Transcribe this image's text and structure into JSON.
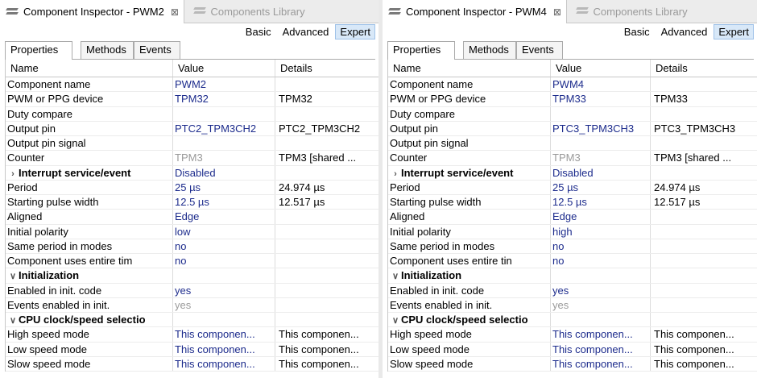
{
  "colors": {
    "value_blue": "#1c2b8c",
    "value_gray": "#9a9a9a",
    "expert_bg": "#d8e8f8"
  },
  "left": {
    "view_tab": "Component Inspector - PWM2",
    "close_glyph": "⊠",
    "library_tab": "Components Library",
    "modes": [
      "Basic",
      "Advanced",
      "Expert"
    ],
    "selected_mode": "Expert",
    "subtabs": [
      "Properties",
      "Methods",
      "Events"
    ],
    "columns": [
      "Name",
      "Value",
      "Details"
    ],
    "rows": [
      {
        "name": "Component name",
        "value": "PWM2",
        "details": "",
        "level": 1,
        "twist": "",
        "bold": false,
        "style": "blue"
      },
      {
        "name": "PWM or PPG device",
        "value": "TPM32",
        "details": "TPM32",
        "level": 1,
        "twist": "",
        "bold": false,
        "style": "blue"
      },
      {
        "name": "Duty compare",
        "value": "",
        "details": "",
        "level": 1,
        "twist": "",
        "bold": false,
        "style": "blue"
      },
      {
        "name": "Output pin",
        "value": "PTC2_TPM3CH2",
        "details": "PTC2_TPM3CH2",
        "level": 1,
        "twist": "",
        "bold": false,
        "style": "blue"
      },
      {
        "name": "Output pin signal",
        "value": "",
        "details": "",
        "level": 1,
        "twist": "",
        "bold": false,
        "style": "blue"
      },
      {
        "name": "Counter",
        "value": "TPM3",
        "details": "TPM3 [shared ...",
        "level": 1,
        "twist": "",
        "bold": false,
        "style": "gray"
      },
      {
        "name": "Interrupt service/event",
        "value": "Disabled",
        "details": "",
        "level": 0,
        "twist": ">",
        "bold": true,
        "style": "blue"
      },
      {
        "name": "Period",
        "value": "25 µs",
        "details": "24.974 µs",
        "level": 1,
        "twist": "",
        "bold": false,
        "style": "blue"
      },
      {
        "name": "Starting pulse width",
        "value": "12.5 µs",
        "details": "12.517 µs",
        "level": 1,
        "twist": "",
        "bold": false,
        "style": "blue"
      },
      {
        "name": "Aligned",
        "value": "Edge",
        "details": "",
        "level": 1,
        "twist": "",
        "bold": false,
        "style": "blue"
      },
      {
        "name": "Initial polarity",
        "value": "low",
        "details": "",
        "level": 1,
        "twist": "",
        "bold": false,
        "style": "blue"
      },
      {
        "name": "Same period in modes",
        "value": "no",
        "details": "",
        "level": 1,
        "twist": "",
        "bold": false,
        "style": "blue"
      },
      {
        "name": "Component uses entire tim",
        "value": "no",
        "details": "",
        "level": 1,
        "twist": "",
        "bold": false,
        "style": "blue"
      },
      {
        "name": "Initialization",
        "value": "",
        "details": "",
        "level": 0,
        "twist": "v",
        "bold": true,
        "style": "blue"
      },
      {
        "name": "Enabled in init. code",
        "value": "yes",
        "details": "",
        "level": 2,
        "twist": "",
        "bold": false,
        "style": "blue"
      },
      {
        "name": "Events enabled in init.",
        "value": "yes",
        "details": "",
        "level": 2,
        "twist": "",
        "bold": false,
        "style": "gray"
      },
      {
        "name": "CPU clock/speed selectio",
        "value": "",
        "details": "",
        "level": 0,
        "twist": "v",
        "bold": true,
        "style": "blue"
      },
      {
        "name": "High speed mode",
        "value": "This componen...",
        "details": "This componen...",
        "level": 2,
        "twist": "",
        "bold": false,
        "style": "blue"
      },
      {
        "name": "Low speed mode",
        "value": "This componen...",
        "details": "This componen...",
        "level": 2,
        "twist": "",
        "bold": false,
        "style": "blue"
      },
      {
        "name": "Slow speed mode",
        "value": "This componen...",
        "details": "This componen...",
        "level": 2,
        "twist": "",
        "bold": false,
        "style": "blue"
      }
    ]
  },
  "right": {
    "view_tab": "Component Inspector - PWM4",
    "close_glyph": "⊠",
    "library_tab": "Components Library",
    "modes": [
      "Basic",
      "Advanced",
      "Expert"
    ],
    "selected_mode": "Expert",
    "subtabs": [
      "Properties",
      "Methods",
      "Events"
    ],
    "columns": [
      "Name",
      "Value",
      "Details"
    ],
    "rows": [
      {
        "name": "Component name",
        "value": "PWM4",
        "details": "",
        "level": 1,
        "twist": "",
        "bold": false,
        "style": "blue"
      },
      {
        "name": "PWM or PPG device",
        "value": "TPM33",
        "details": "TPM33",
        "level": 1,
        "twist": "",
        "bold": false,
        "style": "blue"
      },
      {
        "name": "Duty compare",
        "value": "",
        "details": "",
        "level": 1,
        "twist": "",
        "bold": false,
        "style": "blue"
      },
      {
        "name": "Output pin",
        "value": "PTC3_TPM3CH3",
        "details": "PTC3_TPM3CH3",
        "level": 1,
        "twist": "",
        "bold": false,
        "style": "blue"
      },
      {
        "name": "Output pin signal",
        "value": "",
        "details": "",
        "level": 1,
        "twist": "",
        "bold": false,
        "style": "blue"
      },
      {
        "name": "Counter",
        "value": "TPM3",
        "details": "TPM3 [shared ...",
        "level": 1,
        "twist": "",
        "bold": false,
        "style": "gray"
      },
      {
        "name": "Interrupt service/event",
        "value": "Disabled",
        "details": "",
        "level": 0,
        "twist": ">",
        "bold": true,
        "style": "blue"
      },
      {
        "name": "Period",
        "value": "25 µs",
        "details": "24.974 µs",
        "level": 1,
        "twist": "",
        "bold": false,
        "style": "blue"
      },
      {
        "name": "Starting pulse width",
        "value": "12.5 µs",
        "details": "12.517 µs",
        "level": 1,
        "twist": "",
        "bold": false,
        "style": "blue"
      },
      {
        "name": "Aligned",
        "value": "Edge",
        "details": "",
        "level": 1,
        "twist": "",
        "bold": false,
        "style": "blue"
      },
      {
        "name": "Initial polarity",
        "value": "high",
        "details": "",
        "level": 1,
        "twist": "",
        "bold": false,
        "style": "blue"
      },
      {
        "name": "Same period in modes",
        "value": "no",
        "details": "",
        "level": 1,
        "twist": "",
        "bold": false,
        "style": "blue"
      },
      {
        "name": "Component uses entire tin",
        "value": "no",
        "details": "",
        "level": 1,
        "twist": "",
        "bold": false,
        "style": "blue"
      },
      {
        "name": "Initialization",
        "value": "",
        "details": "",
        "level": 0,
        "twist": "v",
        "bold": true,
        "style": "blue"
      },
      {
        "name": "Enabled in init. code",
        "value": "yes",
        "details": "",
        "level": 2,
        "twist": "",
        "bold": false,
        "style": "blue"
      },
      {
        "name": "Events enabled in init.",
        "value": "yes",
        "details": "",
        "level": 2,
        "twist": "",
        "bold": false,
        "style": "gray"
      },
      {
        "name": "CPU clock/speed selectio",
        "value": "",
        "details": "",
        "level": 0,
        "twist": "v",
        "bold": true,
        "style": "blue"
      },
      {
        "name": "High speed mode",
        "value": "This componen...",
        "details": "This componen...",
        "level": 2,
        "twist": "",
        "bold": false,
        "style": "blue"
      },
      {
        "name": "Low speed mode",
        "value": "This componen...",
        "details": "This componen...",
        "level": 2,
        "twist": "",
        "bold": false,
        "style": "blue"
      },
      {
        "name": "Slow speed mode",
        "value": "This componen...",
        "details": "This componen...",
        "level": 2,
        "twist": "",
        "bold": false,
        "style": "blue"
      }
    ]
  }
}
